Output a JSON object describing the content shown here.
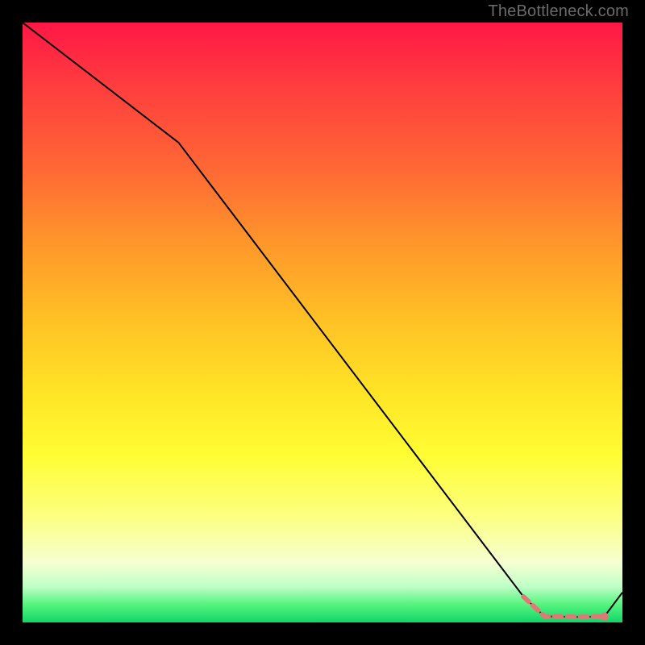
{
  "watermark_text": "TheBottleneck.com",
  "chart_data": {
    "type": "line",
    "title": "",
    "xlabel": "",
    "ylabel": "",
    "x_range": [
      0,
      100
    ],
    "y_range": [
      0,
      100
    ],
    "grid": false,
    "legend": false,
    "background_gradient": {
      "stops": [
        {
          "pos": 0.0,
          "color": "#ff1746"
        },
        {
          "pos": 0.1,
          "color": "#ff3b3f"
        },
        {
          "pos": 0.25,
          "color": "#ff6a34"
        },
        {
          "pos": 0.38,
          "color": "#ff9b2a"
        },
        {
          "pos": 0.5,
          "color": "#ffc225"
        },
        {
          "pos": 0.62,
          "color": "#ffe526"
        },
        {
          "pos": 0.72,
          "color": "#fffd33"
        },
        {
          "pos": 0.82,
          "color": "#fcff7e"
        },
        {
          "pos": 0.9,
          "color": "#f6ffd1"
        },
        {
          "pos": 0.94,
          "color": "#bfffc7"
        },
        {
          "pos": 0.97,
          "color": "#55f47e"
        },
        {
          "pos": 1.0,
          "color": "#10d66a"
        }
      ]
    },
    "series": [
      {
        "name": "curve",
        "stroke": "#000000",
        "stroke_width": 2,
        "x": [
          0.0,
          26.0,
          83.5,
          87.0,
          93.0,
          97.0,
          100.0
        ],
        "y": [
          100.0,
          80.0,
          4.3,
          1.0,
          0.9,
          1.0,
          5.0
        ]
      }
    ],
    "dotted_segment": {
      "series": "curve",
      "x_from": 83.5,
      "x_to": 97.0,
      "stroke": "#e17878",
      "stroke_width": 6,
      "dash": [
        9,
        7
      ]
    },
    "end_marker": {
      "x": 97.0,
      "y": 1.0,
      "r": 5,
      "fill": "#e17878"
    }
  }
}
